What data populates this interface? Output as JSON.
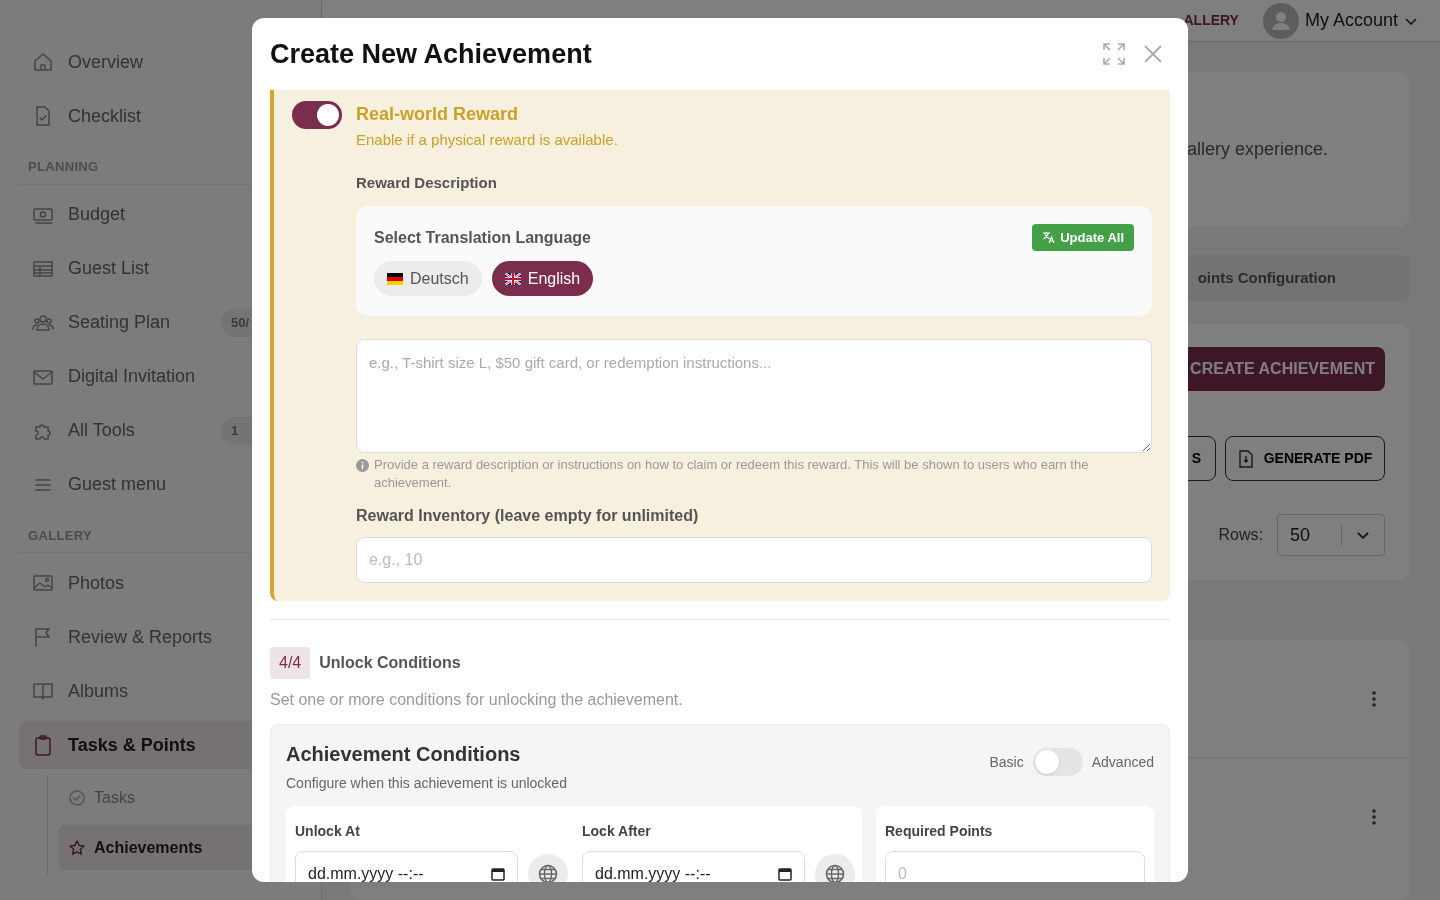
{
  "sidebar": {
    "items": [
      {
        "kind": "link",
        "label": "Overview",
        "selected": false
      },
      {
        "kind": "link",
        "label": "Checklist",
        "selected": false
      },
      {
        "kind": "heading",
        "label": "PLANNING"
      },
      {
        "kind": "link",
        "label": "Budget",
        "selected": false
      },
      {
        "kind": "link",
        "label": "Guest List",
        "selected": false
      },
      {
        "kind": "link",
        "label": "Seating Plan",
        "badge": "50/",
        "selected": false
      },
      {
        "kind": "link",
        "label": "Digital Invitation",
        "selected": false
      },
      {
        "kind": "link",
        "label": "All Tools",
        "badge": "1",
        "selected": false
      },
      {
        "kind": "link",
        "label": "Guest menu",
        "selected": false
      },
      {
        "kind": "heading",
        "label": "GALLERY"
      },
      {
        "kind": "link",
        "label": "Photos",
        "selected": false
      },
      {
        "kind": "link",
        "label": "Review & Reports",
        "selected": false
      },
      {
        "kind": "link",
        "label": "Albums",
        "selected": false
      },
      {
        "kind": "link",
        "label": "Tasks & Points",
        "selected": true,
        "children": [
          {
            "label": "Tasks",
            "selected": false
          },
          {
            "label": "Achievements",
            "selected": true
          }
        ]
      }
    ]
  },
  "top_bar": {
    "link": "ALLERY",
    "account": "My Account"
  },
  "background": {
    "intro": "allery experience.",
    "tab": "oints Configuration",
    "create_button": "CREATE ACHIEVEMENT",
    "buttons": [
      "S",
      "GENERATE PDF"
    ],
    "rows_label": "Rows:",
    "rows_value": "50"
  },
  "dialog": {
    "title": "Create New Achievement",
    "reward": {
      "on": true,
      "title": "Real-world Reward",
      "subtitle": "Enable if a physical reward is available.",
      "description_label": "Reward Description",
      "translation": {
        "label": "Select Translation Language",
        "update_button": "Update All",
        "languages": [
          {
            "label": "Deutsch",
            "selected": false
          },
          {
            "label": "English",
            "selected": true
          }
        ]
      },
      "description_placeholder": "e.g., T-shirt size L, $50 gift card, or redemption instructions...",
      "help": "Provide a reward description or instructions on how to claim or redeem this reward. This will be shown to users who earn the achievement.",
      "inventory_label": "Reward Inventory (leave empty for unlimited)",
      "inventory_placeholder": "e.g., 10"
    },
    "step": {
      "badge": "4/4",
      "title": "Unlock Conditions",
      "description": "Set one or more conditions for unlocking the achievement."
    },
    "conditions": {
      "title": "Achievement Conditions",
      "subtitle": "Configure when this achievement is unlocked",
      "mode": {
        "left": "Basic",
        "right": "Advanced",
        "on": false
      },
      "dates": [
        {
          "label": "Unlock At",
          "value": "dd.mm.yyyy --:--"
        },
        {
          "label": "Lock After",
          "value": "dd.mm.yyyy --:--"
        }
      ],
      "points": {
        "label": "Required Points",
        "placeholder": "0"
      }
    }
  }
}
